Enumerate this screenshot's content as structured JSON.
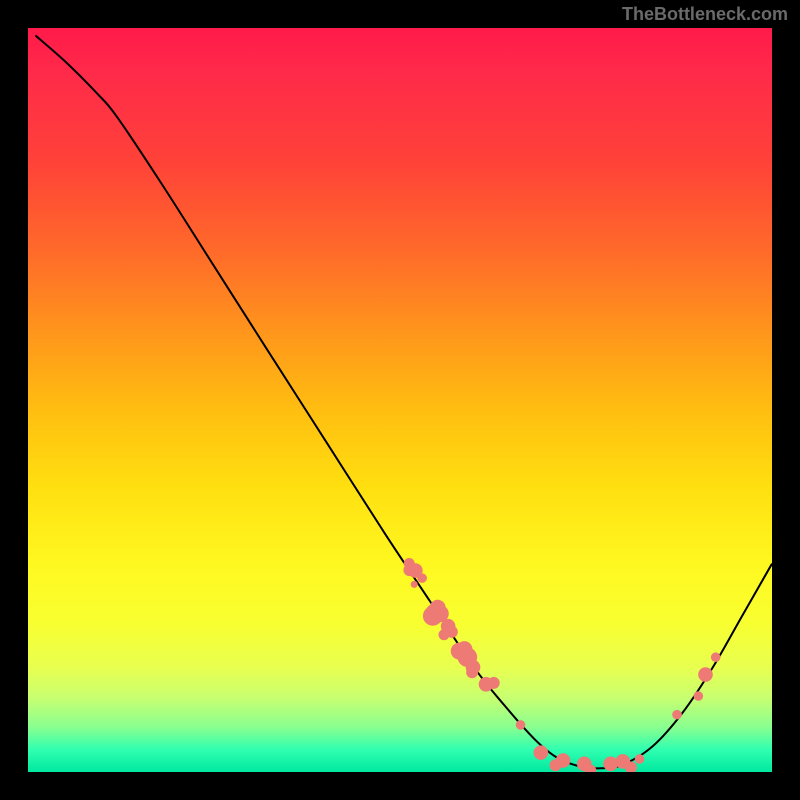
{
  "watermark": "TheBottleneck.com",
  "chart_data": {
    "type": "line",
    "title": "",
    "xlabel": "",
    "ylabel": "",
    "xlim": [
      0,
      100
    ],
    "ylim": [
      0,
      100
    ],
    "grid": false,
    "legend": false,
    "curve_points": [
      {
        "x": 1,
        "y": 99
      },
      {
        "x": 5,
        "y": 95.5
      },
      {
        "x": 9,
        "y": 91.5
      },
      {
        "x": 12,
        "y": 88
      },
      {
        "x": 18,
        "y": 79
      },
      {
        "x": 25,
        "y": 68
      },
      {
        "x": 32,
        "y": 57
      },
      {
        "x": 40,
        "y": 44.5
      },
      {
        "x": 48,
        "y": 32
      },
      {
        "x": 54,
        "y": 23
      },
      {
        "x": 60,
        "y": 14
      },
      {
        "x": 64,
        "y": 9
      },
      {
        "x": 68,
        "y": 4.5
      },
      {
        "x": 71,
        "y": 2
      },
      {
        "x": 74,
        "y": 0.8
      },
      {
        "x": 77,
        "y": 0.5
      },
      {
        "x": 80,
        "y": 1
      },
      {
        "x": 84,
        "y": 3.5
      },
      {
        "x": 88,
        "y": 8
      },
      {
        "x": 92,
        "y": 14
      },
      {
        "x": 96,
        "y": 21
      },
      {
        "x": 100,
        "y": 28
      }
    ],
    "scatter_clusters": [
      {
        "cx": 51.5,
        "cy": 27.5,
        "count": 3,
        "size": "medium"
      },
      {
        "cx": 52.5,
        "cy": 25.5,
        "count": 2,
        "size": "small"
      },
      {
        "cx": 55.0,
        "cy": 21.5,
        "count": 4,
        "size": "large"
      },
      {
        "cx": 56.5,
        "cy": 19.0,
        "count": 3,
        "size": "medium"
      },
      {
        "cx": 58.5,
        "cy": 16.0,
        "count": 3,
        "size": "large"
      },
      {
        "cx": 60.0,
        "cy": 14.0,
        "count": 2,
        "size": "medium"
      },
      {
        "cx": 62.0,
        "cy": 11.5,
        "count": 2,
        "size": "medium"
      },
      {
        "cx": 66.5,
        "cy": 5.8,
        "count": 1,
        "size": "small"
      },
      {
        "cx": 69.0,
        "cy": 3.2,
        "count": 1,
        "size": "medium"
      },
      {
        "cx": 71.5,
        "cy": 1.5,
        "count": 2,
        "size": "medium"
      },
      {
        "cx": 75.0,
        "cy": 0.6,
        "count": 2,
        "size": "medium"
      },
      {
        "cx": 78.0,
        "cy": 0.6,
        "count": 1,
        "size": "medium"
      },
      {
        "cx": 80.5,
        "cy": 1.2,
        "count": 2,
        "size": "medium"
      },
      {
        "cx": 82.0,
        "cy": 2.0,
        "count": 1,
        "size": "small"
      },
      {
        "cx": 87.5,
        "cy": 7.5,
        "count": 1,
        "size": "small"
      },
      {
        "cx": 89.5,
        "cy": 10.5,
        "count": 1,
        "size": "small"
      },
      {
        "cx": 91.0,
        "cy": 12.5,
        "count": 1,
        "size": "medium"
      },
      {
        "cx": 93.0,
        "cy": 16.0,
        "count": 1,
        "size": "small"
      }
    ]
  }
}
